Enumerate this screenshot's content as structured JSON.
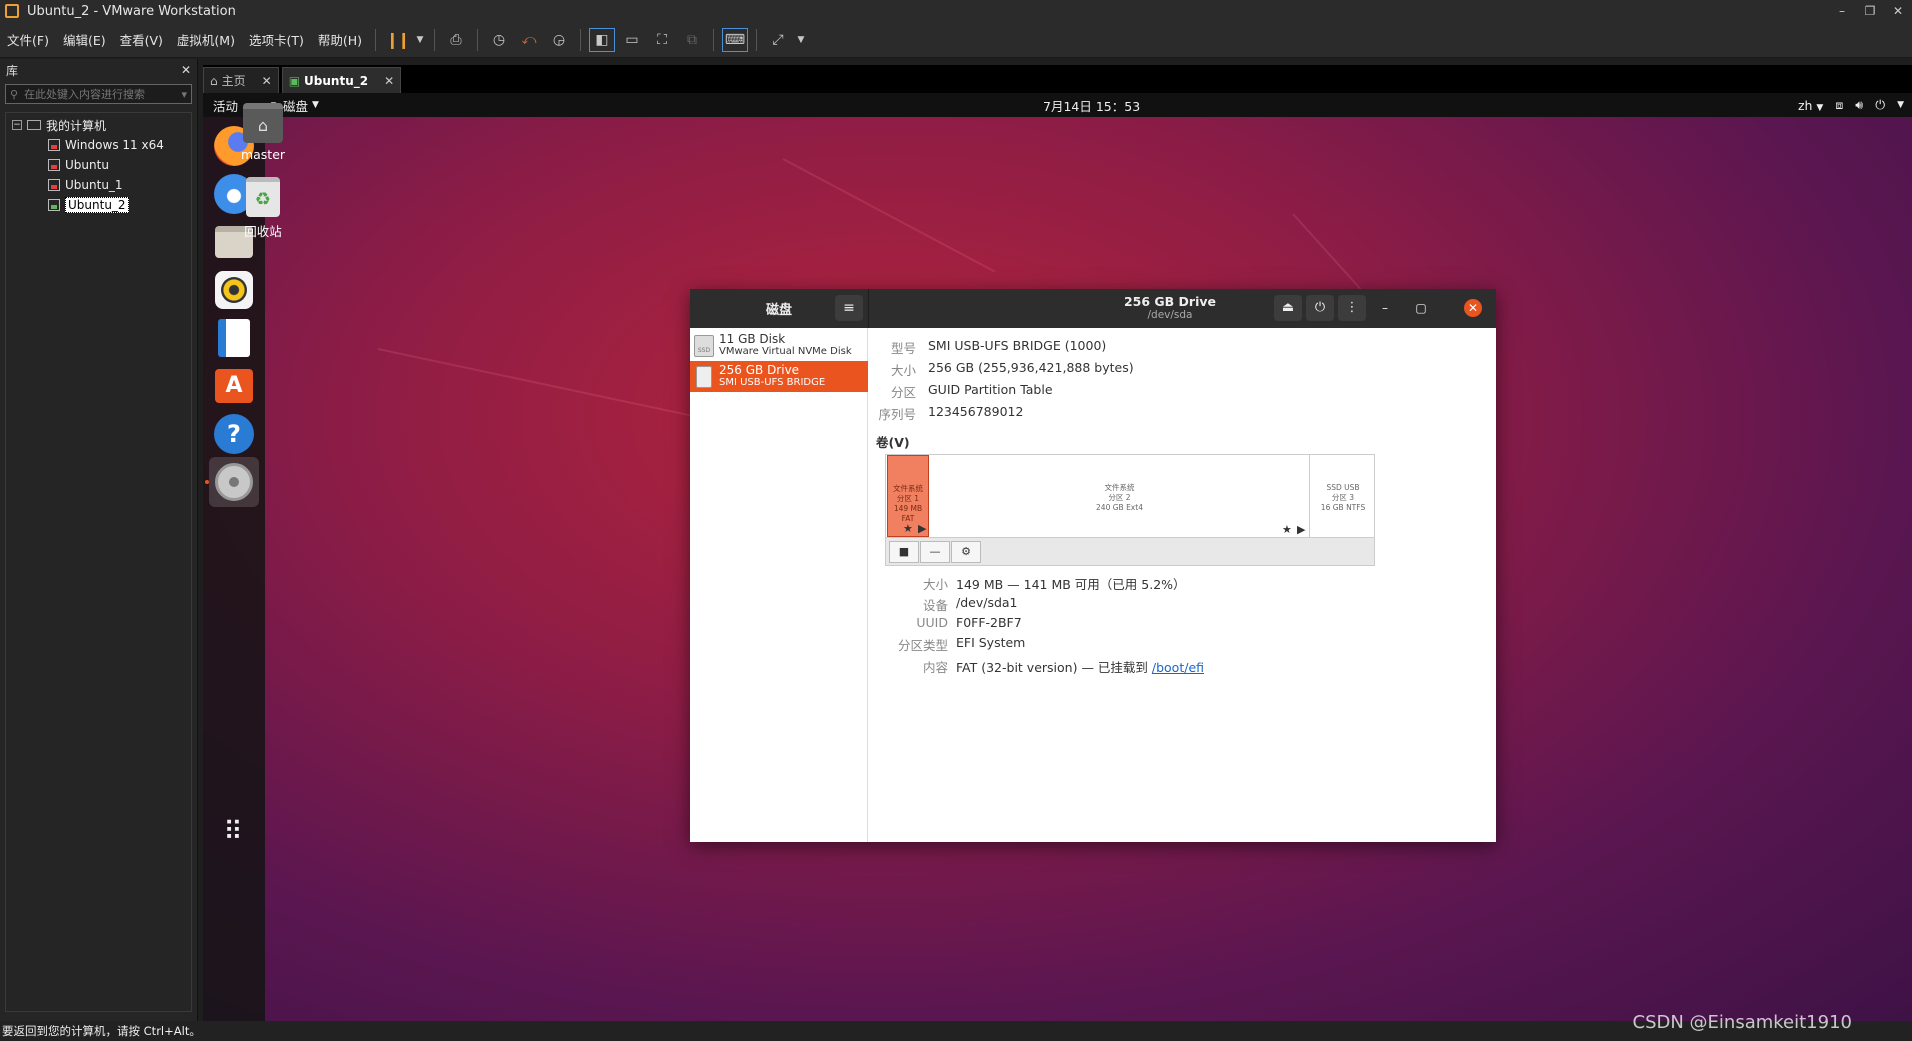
{
  "window": {
    "title": "Ubuntu_2 - VMware Workstation"
  },
  "menu": [
    "文件(F)",
    "编辑(E)",
    "查看(V)",
    "虚拟机(M)",
    "选项卡(T)",
    "帮助(H)"
  ],
  "library": {
    "title": "库",
    "search_placeholder": "在此处键入内容进行搜索",
    "root": "我的计算机",
    "vms": [
      "Windows 11 x64",
      "Ubuntu",
      "Ubuntu_1",
      "Ubuntu_2"
    ]
  },
  "tabs": [
    {
      "label": "主页"
    },
    {
      "label": "Ubuntu_2"
    }
  ],
  "gnome": {
    "activities": "活动",
    "app_name": "磁盘",
    "clock": "7月14日  15：53",
    "lang": "zh"
  },
  "desktop": {
    "home_label": "master",
    "trash_label": "回收站"
  },
  "disks": {
    "sidebar_title": "磁盘",
    "drive_title": "256 GB Drive",
    "drive_subtitle": "/dev/sda",
    "list": [
      {
        "name": "11 GB Disk",
        "desc": "VMware Virtual NVMe Disk"
      },
      {
        "name": "256 GB Drive",
        "desc": "SMI USB-UFS BRIDGE"
      }
    ],
    "props": [
      {
        "key": "型号",
        "value": "SMI USB-UFS BRIDGE (1000)"
      },
      {
        "key": "大小",
        "value": "256 GB (255,936,421,888 bytes)"
      },
      {
        "key": "分区",
        "value": "GUID Partition Table"
      },
      {
        "key": "序列号",
        "value": "123456789012"
      }
    ],
    "volumes_label": "卷(V)",
    "partitions": [
      {
        "l1": "文件系统",
        "l2": "分区 1",
        "l3": "149 MB FAT"
      },
      {
        "l1": "文件系统",
        "l2": "分区 2",
        "l3": "240 GB Ext4"
      },
      {
        "l1": "SSD USB",
        "l2": "分区 3",
        "l3": "16 GB NTFS"
      }
    ],
    "part_props": [
      {
        "key": "大小",
        "value": "149 MB — 141 MB 可用（已用 5.2%）"
      },
      {
        "key": "设备",
        "value": "/dev/sda1"
      },
      {
        "key": "UUID",
        "value": "F0FF-2BF7"
      },
      {
        "key": "分区类型",
        "value": "EFI System"
      },
      {
        "key": "内容",
        "value": "FAT (32-bit version) — 已挂载到 ",
        "link": "/boot/efi"
      }
    ]
  },
  "status": {
    "text": "要返回到您的计算机，请按 Ctrl+Alt。"
  },
  "watermark": "CSDN @Einsamkeit1910",
  "colors": {
    "accent": "#e9541f",
    "link": "#1a66c8"
  }
}
